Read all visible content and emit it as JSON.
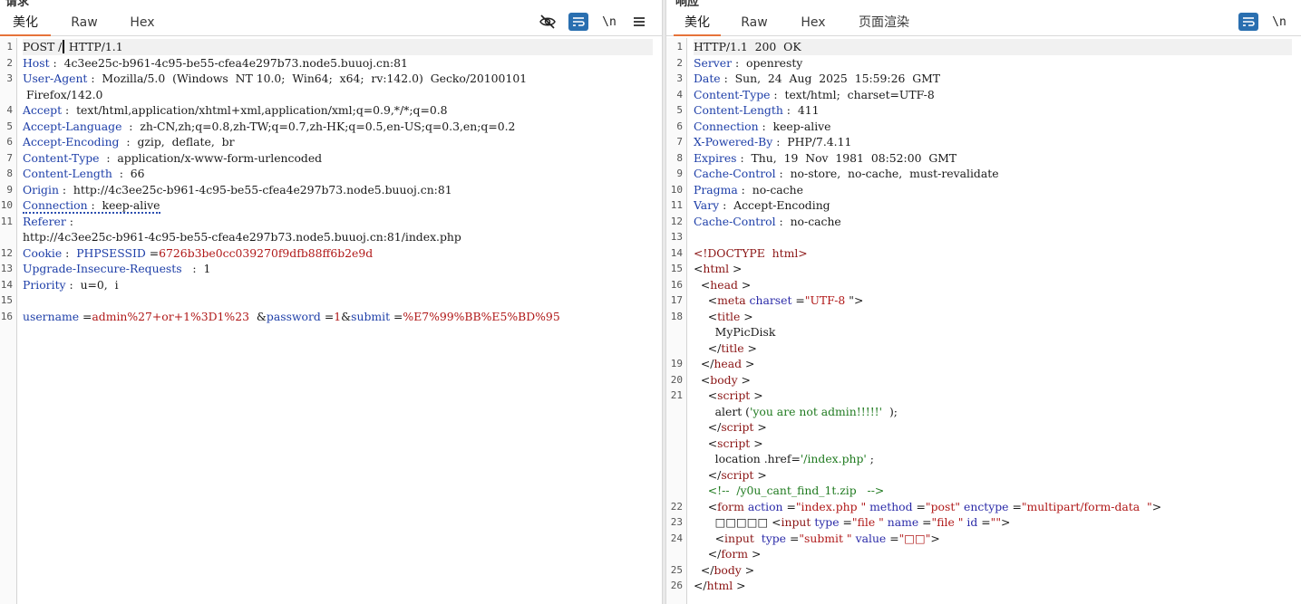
{
  "request": {
    "title": "请求",
    "tabs": [
      "美化",
      "Raw",
      "Hex"
    ],
    "active_tab": 0,
    "tools": {
      "newline": "\\n"
    },
    "gutter": [
      "1",
      "2",
      "3",
      "",
      "4",
      "5",
      "6",
      "7",
      "8",
      "9",
      "10",
      "11",
      "",
      "12",
      "13",
      "14",
      "15",
      "16"
    ],
    "lines": {
      "l1": {
        "method": "POST /",
        "rest": " HTTP/1.1"
      },
      "l2": {
        "key": "Host",
        "sep": " :  ",
        "val": "4c3ee25c-b961-4c95-be55-cfea4e297b73.node5.buuoj.cn:81"
      },
      "l3": {
        "key": "User-Agent",
        "sep": " :  ",
        "val": "Mozilla/5.0  (Windows  NT 10.0;  Win64;  x64;  rv:142.0)  Gecko/20100101"
      },
      "l3b": {
        "val": " Firefox/142.0"
      },
      "l4": {
        "key": "Accept",
        "sep": " :  ",
        "val": "text/html,application/xhtml+xml,application/xml;q=0.9,*/*;q=0.8"
      },
      "l5": {
        "key": "Accept-Language",
        "sep": "  :  ",
        "val": "zh-CN,zh;q=0.8,zh-TW;q=0.7,zh-HK;q=0.5,en-US;q=0.3,en;q=0.2"
      },
      "l6": {
        "key": "Accept-Encoding",
        "sep": "  :  ",
        "val": "gzip,  deflate,  br"
      },
      "l7": {
        "key": "Content-Type",
        "sep": "  :  ",
        "val": "application/x-www-form-urlencoded"
      },
      "l8": {
        "key": "Content-Length",
        "sep": "  :  ",
        "val": "66"
      },
      "l9": {
        "key": "Origin",
        "sep": " :  ",
        "val": "http://4c3ee25c-b961-4c95-be55-cfea4e297b73.node5.buuoj.cn:81"
      },
      "l10": {
        "key": "Connection",
        "sep": " :  ",
        "val": "keep-alive"
      },
      "l11": {
        "key": "Referer",
        "sep": " :",
        "val": ""
      },
      "l11b": {
        "val": "http://4c3ee25c-b961-4c95-be55-cfea4e297b73.node5.buuoj.cn:81/index.php"
      },
      "l12": {
        "key": "Cookie",
        "sep": " :  ",
        "ck": "PHPSESSID",
        "eq": " =",
        "cv": "6726b3be0cc039270f9dfb88ff6b2e9d"
      },
      "l13": {
        "key": "Upgrade-Insecure-Requests",
        "sep": "   :  ",
        "val": "1"
      },
      "l14": {
        "key": "Priority",
        "sep": " :  ",
        "val": "u=0,  i"
      },
      "l16": {
        "k1": "username",
        "e1": " =",
        "v1": "admin%27+or+1%3D1%23",
        "amp1": "  &",
        "k2": "password",
        "e2": " =",
        "v2": "1",
        "amp2": "&",
        "k3": "submit",
        "e3": " =",
        "v3": "%E7%99%BB%E5%BD%95"
      }
    }
  },
  "response": {
    "title": "响应",
    "tabs": [
      "美化",
      "Raw",
      "Hex",
      "页面渲染"
    ],
    "active_tab": 0,
    "tools": {
      "newline": "\\n"
    },
    "gutter": [
      "1",
      "2",
      "3",
      "4",
      "5",
      "6",
      "7",
      "8",
      "9",
      "10",
      "11",
      "12",
      "13",
      "14",
      "15",
      "16",
      "17",
      "18",
      "",
      "",
      "19",
      "20",
      "21",
      "",
      "",
      "",
      "",
      "",
      "",
      "22",
      "23",
      "24",
      "",
      "25",
      "26"
    ],
    "lines": {
      "r1": "HTTP/1.1  200  OK",
      "r2": {
        "key": "Server",
        "sep": " :  ",
        "val": "openresty"
      },
      "r3": {
        "key": "Date",
        "sep": " :  ",
        "val": "Sun,  24  Aug  2025  15:59:26  GMT"
      },
      "r4": {
        "key": "Content-Type",
        "sep": " :  ",
        "val": "text/html;  charset=UTF-8"
      },
      "r5": {
        "key": "Content-Length",
        "sep": " :  ",
        "val": "411"
      },
      "r6": {
        "key": "Connection",
        "sep": " :  ",
        "val": "keep-alive"
      },
      "r7": {
        "key": "X-Powered-By",
        "sep": " :  ",
        "val": "PHP/7.4.11"
      },
      "r8": {
        "key": "Expires",
        "sep": " :  ",
        "val": "Thu,  19  Nov  1981  08:52:00  GMT"
      },
      "r9": {
        "key": "Cache-Control",
        "sep": " :  ",
        "val": "no-store,  no-cache,  must-revalidate"
      },
      "r10": {
        "key": "Pragma",
        "sep": " :  ",
        "val": "no-cache"
      },
      "r11": {
        "key": "Vary",
        "sep": " :  ",
        "val": "Accept-Encoding"
      },
      "r12": {
        "key": "Cache-Control",
        "sep": " :  ",
        "val": "no-cache"
      },
      "r14": "<!DOCTYPE  html>",
      "tag_html": "html",
      "tag_head": "head",
      "tag_meta": "meta",
      "attr_charset": "charset",
      "val_utf8": "\"UTF-8",
      "tag_title": "title",
      "title_text": "MyPicDisk",
      "tag_body": "body",
      "tag_script": "script",
      "alert_fn": "alert",
      "alert_str": "'you are not admin!!!!!'",
      "alert_end": "  );",
      "loc_code": "location .href",
      "loc_str": "'/index.php'",
      "loc_end": " ;",
      "comment": "<!--  /y0u_cant_find_1t.zip   -->",
      "tag_form": "form",
      "attr_action": "action",
      "val_action": "\"index.php \"",
      "attr_method": "method",
      "val_method": "\"post\"",
      "attr_enctype": "enctype",
      "val_enctype": "\"multipart/form-data  \"",
      "garbled1": "□□□□□",
      "tag_input": "input",
      "attr_type": "type",
      "val_file": "\"file \"",
      "attr_name": "name",
      "val_name": "\"file \"",
      "attr_id": "id",
      "val_id": "\"\"",
      "val_submit": "\"submit \"",
      "attr_value": "value",
      "val_value": "\"□□\""
    }
  }
}
